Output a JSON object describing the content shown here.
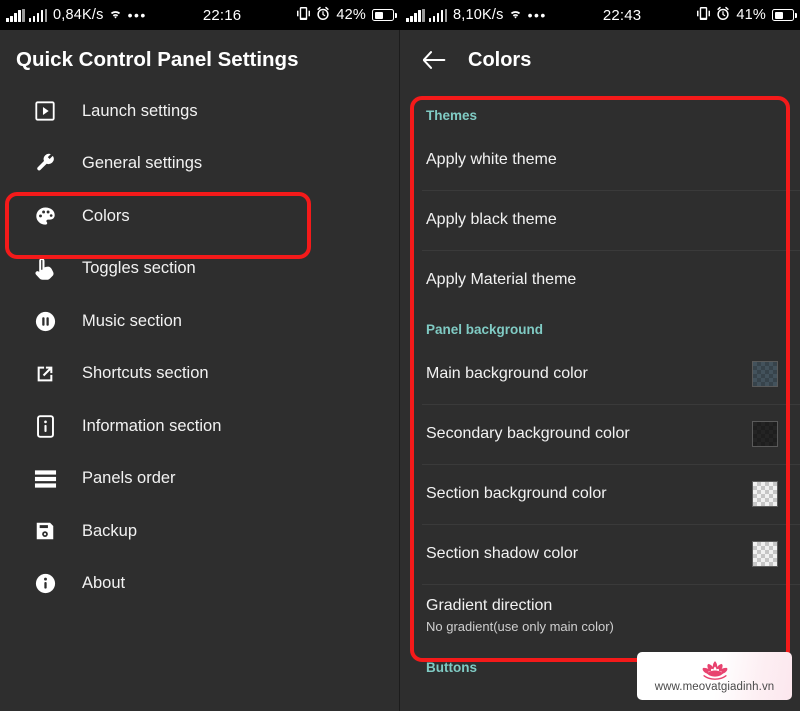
{
  "status_bar_left": {
    "network_speed": "0,84K/s",
    "time": "22:16",
    "battery_percent": "42%",
    "icons": [
      "signal-bars-icon",
      "signal-bars-icon",
      "wifi-icon",
      "more-dots-icon",
      "vibrate-icon",
      "alarm-icon",
      "battery-icon"
    ]
  },
  "status_bar_right": {
    "network_speed": "8,10K/s",
    "time": "22:43",
    "battery_percent": "41%",
    "icons": [
      "signal-bars-icon",
      "signal-bars-icon",
      "wifi-icon",
      "more-dots-icon",
      "vibrate-icon",
      "alarm-icon",
      "battery-icon"
    ]
  },
  "left_panel": {
    "title": "Quick Control Panel Settings",
    "menu": [
      {
        "label": "Launch settings",
        "icon": "play-square-icon"
      },
      {
        "label": "General settings",
        "icon": "wrench-icon"
      },
      {
        "label": "Colors",
        "icon": "palette-icon",
        "highlighted": true
      },
      {
        "label": "Toggles section",
        "icon": "tap-hand-icon"
      },
      {
        "label": "Music section",
        "icon": "pause-circle-icon"
      },
      {
        "label": "Shortcuts section",
        "icon": "external-link-icon"
      },
      {
        "label": "Information section",
        "icon": "info-rect-icon"
      },
      {
        "label": "Panels order",
        "icon": "stacked-lines-icon"
      },
      {
        "label": "Backup",
        "icon": "floppy-disk-icon"
      },
      {
        "label": "About",
        "icon": "info-circle-icon"
      }
    ]
  },
  "right_panel": {
    "back_icon": "back-arrow-icon",
    "title": "Colors",
    "sections": [
      {
        "header": "Themes",
        "rows": [
          {
            "title": "Apply white theme"
          },
          {
            "title": "Apply black theme"
          },
          {
            "title": "Apply Material theme"
          }
        ]
      },
      {
        "header": "Panel background",
        "rows": [
          {
            "title": "Main background color",
            "swatch": "#43525c",
            "swatch_checker": true
          },
          {
            "title": "Secondary background color",
            "swatch": "#242424",
            "swatch_checker": true
          },
          {
            "title": "Section background color",
            "swatch": "#f0f0f0",
            "swatch_checker": true
          },
          {
            "title": "Section shadow color",
            "swatch": "#f0f0f0",
            "swatch_checker": true
          },
          {
            "title": "Gradient direction",
            "subtitle": "No gradient(use only main color)"
          }
        ]
      },
      {
        "header": "Buttons",
        "rows": []
      }
    ]
  },
  "annotations": {
    "highlight_color": "#f41a1a",
    "boxes": [
      "colors-menu-item",
      "colors-settings-list"
    ]
  },
  "watermark": {
    "url": "www.meovatgiadinh.vn",
    "logo": "lotus-flower-logo",
    "logo_color": "#e8436f"
  },
  "theme": {
    "background": "#2e2e2e",
    "section_header_color": "#80cbc4",
    "text_color": "#f2f2f2",
    "statusbar_background": "#000000"
  }
}
